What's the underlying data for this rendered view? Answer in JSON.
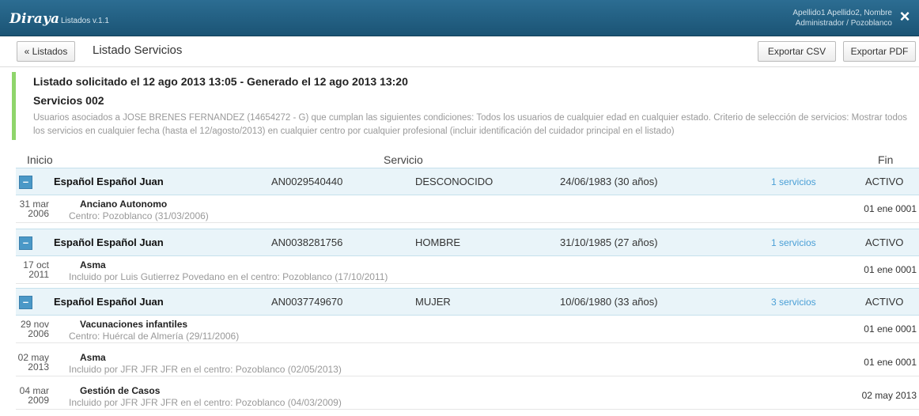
{
  "app": {
    "brand": "Diraya",
    "subtitle": "Listados v.1.1",
    "user_line1": "Apellido1 Apellido2, Nombre",
    "user_line2": "Administrador / Pozoblanco",
    "close_icon": "×"
  },
  "toolbar": {
    "back_label": "« Listados",
    "title": "Listado Servicios",
    "csv_label": "Exportar CSV",
    "pdf_label": "Exportar PDF"
  },
  "info": {
    "title": "Listado solicitado el 12 ago 2013 13:05 - Generado el 12 ago 2013 13:20",
    "subtitle": "Servicios 002",
    "description": "Usuarios asociados a JOSE BRENES FERNANDEZ (14654272 - G) que cumplan las siguientes condiciones: Todos los usuarios de cualquier edad en cualquier estado. Criterio de selección de servicios: Mostrar todos los servicios en cualquier fecha (hasta el 12/agosto/2013) en cualquier centro por cualquier profesional (incluir identificación del cuidador principal en el listado)"
  },
  "columns": {
    "inicio": "Inicio",
    "servicio": "Servicio",
    "fin": "Fin"
  },
  "persons": [
    {
      "name": "Español Español Juan",
      "id": "AN0029540440",
      "sex": "DESCONOCIDO",
      "birth": "24/06/1983 (30 años)",
      "count": "1 servicios",
      "status": "ACTIVO",
      "expand": "–",
      "services": [
        {
          "day": "31 mar",
          "year": "2006",
          "name": "Anciano Autonomo",
          "desc": "Centro: Pozoblanco (31/03/2006)",
          "end": "01 ene 0001"
        }
      ]
    },
    {
      "name": "Español Español Juan",
      "id": "AN0038281756",
      "sex": "HOMBRE",
      "birth": "31/10/1985 (27 años)",
      "count": "1 servicios",
      "status": "ACTIVO",
      "expand": "–",
      "services": [
        {
          "day": "17 oct",
          "year": "2011",
          "name": "Asma",
          "desc": "Incluido por Luis Gutierrez Povedano en el centro: Pozoblanco (17/10/2011)",
          "end": "01 ene 0001"
        }
      ]
    },
    {
      "name": "Español Español Juan",
      "id": "AN0037749670",
      "sex": "MUJER",
      "birth": "10/06/1980 (33 años)",
      "count": "3 servicios",
      "status": "ACTIVO",
      "expand": "–",
      "services": [
        {
          "day": "29 nov",
          "year": "2006",
          "name": "Vacunaciones infantiles",
          "desc": "Centro: Huércal de Almería (29/11/2006)",
          "end": "01 ene 0001"
        },
        {
          "day": "02 may",
          "year": "2013",
          "name": "Asma",
          "desc": "Incluido por JFR JFR JFR en el centro: Pozoblanco (02/05/2013)",
          "end": "01 ene 0001"
        },
        {
          "day": "04 mar",
          "year": "2009",
          "name": "Gestión de Casos",
          "desc": "Incluido por JFR JFR JFR en el centro: Pozoblanco (04/03/2009)",
          "end": "02 may 2013"
        }
      ]
    }
  ]
}
